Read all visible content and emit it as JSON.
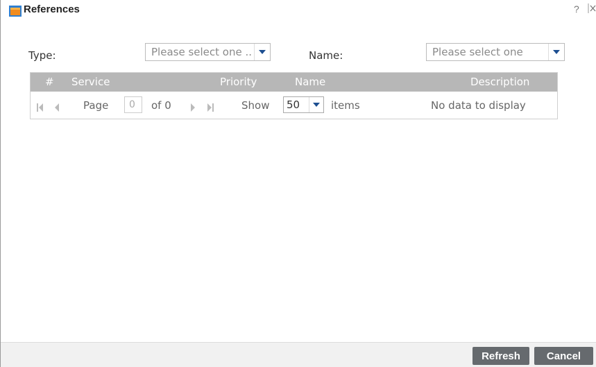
{
  "window": {
    "title": "References",
    "help_label": "?",
    "close_label": "×"
  },
  "filters": {
    "type_label": "Type:",
    "type_value": "Please select one ..",
    "name_label": "Name:",
    "name_value": "Please select one"
  },
  "grid": {
    "columns": [
      "#",
      "Service",
      "Priority",
      "Name",
      "Description"
    ],
    "paging": {
      "page_label": "Page",
      "page_value": "0",
      "of_label": "of 0",
      "show_label": "Show",
      "show_value": "50",
      "items_label": "items",
      "empty_text": "No data to display"
    }
  },
  "footer": {
    "refresh_label": "Refresh",
    "cancel_label": "Cancel"
  },
  "colors": {
    "header_bg": "#b7b7b7",
    "button_bg": "#666a6e",
    "accent": "#1d4f91"
  }
}
